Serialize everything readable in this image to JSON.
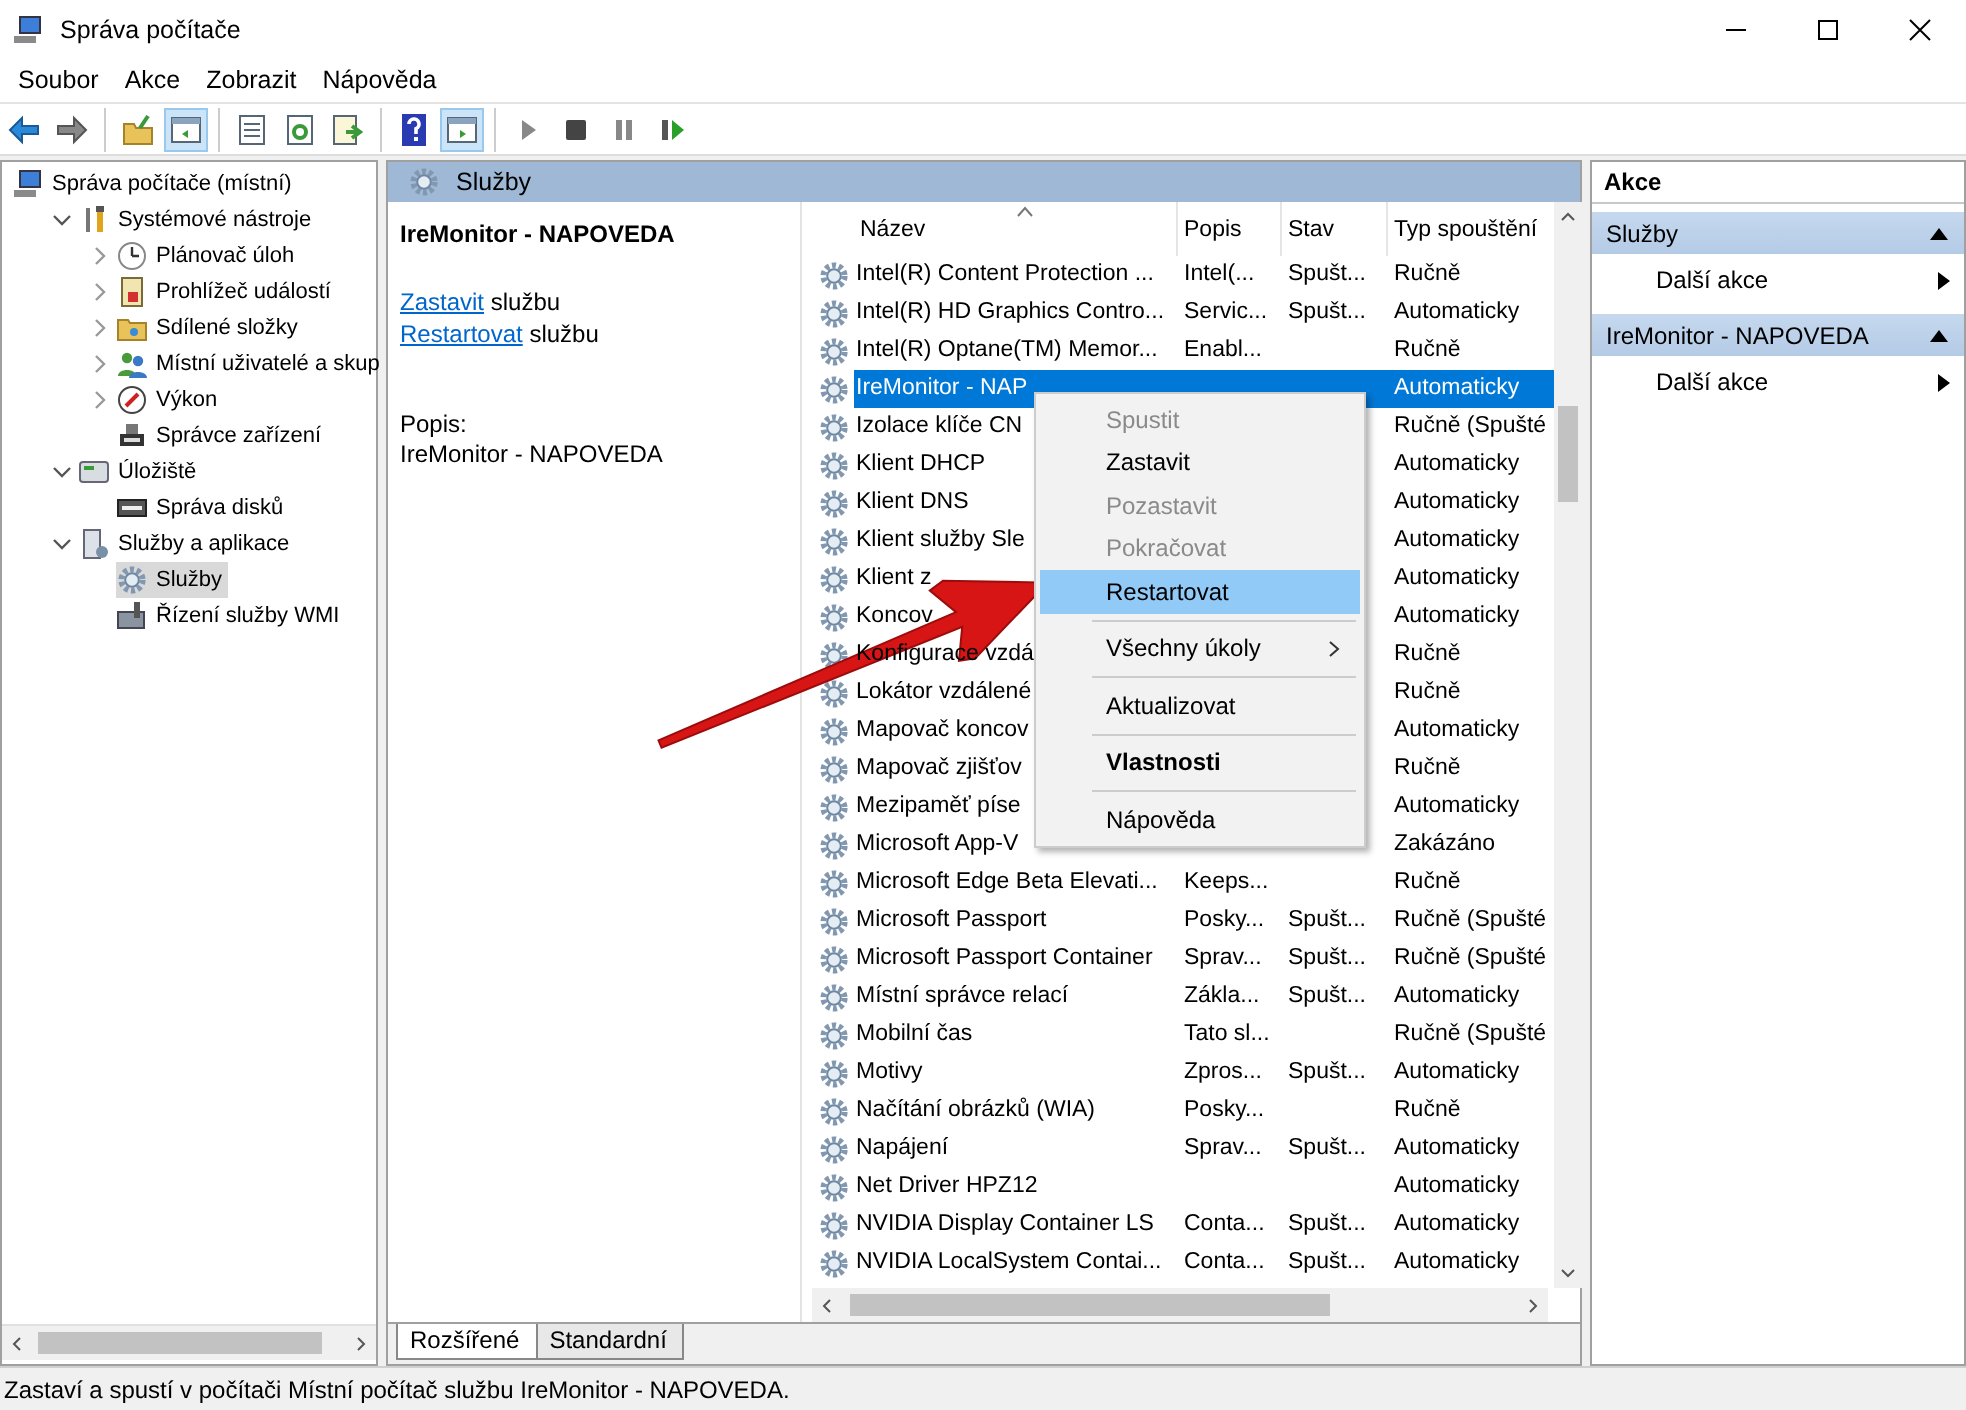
{
  "window": {
    "title": "Správa počítače"
  },
  "menu": [
    "Soubor",
    "Akce",
    "Zobrazit",
    "Nápověda"
  ],
  "toolbar": [
    [
      {
        "kind": "back",
        "pressed": false
      },
      {
        "kind": "forward",
        "pressed": false
      }
    ],
    [
      {
        "kind": "up",
        "pressed": false
      },
      {
        "kind": "tree",
        "pressed": true
      }
    ],
    [
      {
        "kind": "properties",
        "pressed": false
      },
      {
        "kind": "refresh",
        "pressed": false
      },
      {
        "kind": "export",
        "pressed": false
      }
    ],
    [
      {
        "kind": "help",
        "pressed": false
      },
      {
        "kind": "actionpane",
        "pressed": true
      }
    ],
    [
      {
        "kind": "play",
        "pressed": false
      },
      {
        "kind": "stop",
        "pressed": false
      },
      {
        "kind": "pause",
        "pressed": false
      },
      {
        "kind": "resume",
        "pressed": false
      }
    ]
  ],
  "tree": [
    {
      "label": "Správa počítače (místní)",
      "selected": false,
      "children": [
        {
          "label": "Systémové nástroje",
          "expanded": true,
          "selected": false,
          "children": [
            {
              "label": "Plánovač úloh",
              "expanded": false,
              "selected": false
            },
            {
              "label": "Prohlížeč událostí",
              "expanded": false,
              "selected": false
            },
            {
              "label": "Sdílené složky",
              "expanded": false,
              "selected": false
            },
            {
              "label": "Místní uživatelé a skup",
              "expanded": false,
              "selected": false
            },
            {
              "label": "Výkon",
              "expanded": false,
              "selected": false
            },
            {
              "label": "Správce zařízení",
              "selected": false
            }
          ]
        },
        {
          "label": "Úložiště",
          "expanded": true,
          "selected": false,
          "children": [
            {
              "label": "Správa disků",
              "selected": false
            }
          ]
        },
        {
          "label": "Služby a aplikace",
          "expanded": true,
          "selected": false,
          "children": [
            {
              "label": "Služby",
              "selected": true
            },
            {
              "label": "Řízení služby WMI",
              "selected": false
            }
          ]
        }
      ]
    }
  ],
  "center": {
    "title": "Služby",
    "detail": {
      "name": "IreMonitor - NAPOVEDA",
      "actions": [
        {
          "link": "Zastavit",
          "text": "službu"
        },
        {
          "link": "Restartovat",
          "text": "službu"
        }
      ],
      "description_label": "Popis:",
      "description": "IreMonitor - NAPOVEDA"
    }
  },
  "table": {
    "columns": [
      {
        "label": "Název",
        "sorted": true
      },
      {
        "label": "Popis",
        "sorted": false
      },
      {
        "label": "Stav",
        "sorted": false
      },
      {
        "label": "Typ spouštění",
        "sorted": false
      }
    ],
    "rows": [
      {
        "name": "Intel(R) Content Protection ...",
        "description": "Intel(...",
        "status": "Spušt...",
        "startup": "Ručně",
        "selected": false
      },
      {
        "name": "Intel(R) HD Graphics Contro...",
        "description": "Servic...",
        "status": "Spušt...",
        "startup": "Automaticky",
        "selected": false
      },
      {
        "name": "Intel(R) Optane(TM) Memor...",
        "description": "Enabl...",
        "startup": "Ručně",
        "selected": false
      },
      {
        "name": "IreMonitor - NAP",
        "startup": "Automaticky",
        "selected": true
      },
      {
        "name": "Izolace klíče CN",
        "startup": "Ručně (Spušté",
        "selected": false
      },
      {
        "name": "Klient DHCP",
        "startup": "Automaticky",
        "selected": false
      },
      {
        "name": "Klient DNS",
        "startup": "Automaticky",
        "selected": false
      },
      {
        "name": "Klient služby Sle",
        "startup": "Automaticky",
        "selected": false
      },
      {
        "name": "Klient z",
        "startup": "Automaticky",
        "selected": false
      },
      {
        "name": "Koncov",
        "startup": "Automaticky",
        "selected": false
      },
      {
        "name": "Konfigurace vzdá",
        "startup": "Ručně",
        "selected": false
      },
      {
        "name": "Lokátor vzdálené",
        "startup": "Ručně",
        "selected": false
      },
      {
        "name": "Mapovač koncov",
        "startup": "Automaticky",
        "selected": false
      },
      {
        "name": "Mapovač zjišťov",
        "startup": "Ručně",
        "selected": false
      },
      {
        "name": "Mezipaměť píse",
        "startup": "Automaticky",
        "selected": false
      },
      {
        "name": "Microsoft App-V",
        "startup": "Zakázáno",
        "selected": false
      },
      {
        "name": "Microsoft Edge Beta Elevati...",
        "description": "Keeps...",
        "startup": "Ručně",
        "selected": false
      },
      {
        "name": "Microsoft Passport",
        "description": "Posky...",
        "status": "Spušt...",
        "startup": "Ručně (Spušté",
        "selected": false
      },
      {
        "name": "Microsoft Passport Container",
        "description": "Sprav...",
        "status": "Spušt...",
        "startup": "Ručně (Spušté",
        "selected": false
      },
      {
        "name": "Místní správce relací",
        "description": "Zákla...",
        "status": "Spušt...",
        "startup": "Automaticky",
        "selected": false
      },
      {
        "name": "Mobilní čas",
        "description": "Tato sl...",
        "startup": "Ručně (Spušté",
        "selected": false
      },
      {
        "name": "Motivy",
        "description": "Zpros...",
        "status": "Spušt...",
        "startup": "Automaticky",
        "selected": false
      },
      {
        "name": "Načítání obrázků (WIA)",
        "description": "Posky...",
        "startup": "Ručně",
        "selected": false
      },
      {
        "name": "Napájení",
        "description": "Sprav...",
        "status": "Spušt...",
        "startup": "Automaticky",
        "selected": false
      },
      {
        "name": "Net Driver HPZ12",
        "startup": "Automaticky",
        "selected": false
      },
      {
        "name": "NVIDIA Display Container LS",
        "description": "Conta...",
        "status": "Spušt...",
        "startup": "Automaticky",
        "selected": false
      },
      {
        "name": "NVIDIA LocalSystem Contai...",
        "description": "Conta...",
        "status": "Spušt...",
        "startup": "Automaticky",
        "selected": false
      }
    ]
  },
  "view_tabs": [
    {
      "label": "Rozšířené",
      "selected": true
    },
    {
      "label": "Standardní",
      "selected": false
    }
  ],
  "context_menu": [
    {
      "kind": "item",
      "label": "Spustit",
      "disabled": true,
      "highlighted": false,
      "default": false
    },
    {
      "kind": "item",
      "label": "Zastavit",
      "disabled": false,
      "highlighted": false,
      "default": false
    },
    {
      "kind": "item",
      "label": "Pozastavit",
      "disabled": true,
      "highlighted": false,
      "default": false
    },
    {
      "kind": "item",
      "label": "Pokračovat",
      "disabled": true,
      "highlighted": false,
      "default": false
    },
    {
      "kind": "item",
      "label": "Restartovat",
      "disabled": false,
      "highlighted": true,
      "default": false
    },
    {
      "kind": "separator"
    },
    {
      "kind": "submenu",
      "label": "Všechny úkoly",
      "disabled": false,
      "highlighted": false,
      "default": false
    },
    {
      "kind": "separator"
    },
    {
      "kind": "item",
      "label": "Aktualizovat",
      "disabled": false,
      "highlighted": false,
      "default": false
    },
    {
      "kind": "separator"
    },
    {
      "kind": "item",
      "label": "Vlastnosti",
      "disabled": false,
      "highlighted": false,
      "default": true
    },
    {
      "kind": "separator"
    },
    {
      "kind": "item",
      "label": "Nápověda",
      "disabled": false,
      "highlighted": false,
      "default": false
    }
  ],
  "actions_pane": {
    "title": "Akce",
    "sections": [
      {
        "title": "Služby",
        "expanded": true,
        "items": [
          "Další akce"
        ]
      },
      {
        "title": "IreMonitor - NAPOVEDA",
        "expanded": true,
        "items": [
          "Další akce"
        ]
      }
    ]
  },
  "status_bar": "Zastaví a spustí v počítači Místní počítač službu IreMonitor - NAPOVEDA."
}
